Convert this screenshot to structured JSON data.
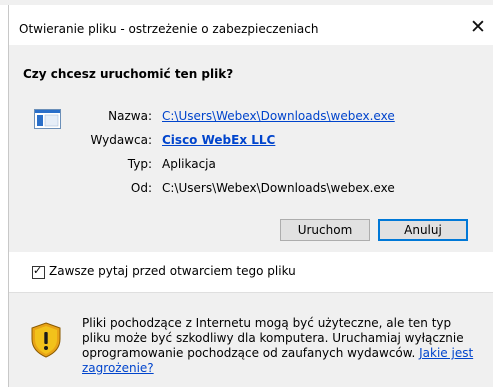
{
  "window": {
    "title": "Otwieranie pliku - ostrzeżenie o zabezpieczeniach",
    "close_glyph": "✕"
  },
  "main": {
    "heading": "Czy chcesz uruchomić ten plik?",
    "icon": "executable-file-icon",
    "fields": {
      "name_label": "Nazwa:",
      "name_value": "C:\\Users\\Webex\\Downloads\\webex.exe",
      "publisher_label": "Wydawca:",
      "publisher_value": "Cisco WebEx LLC",
      "type_label": "Typ:",
      "type_value": "Aplikacja",
      "from_label": "Od:",
      "from_value": "C:\\Users\\Webex\\Downloads\\webex.exe"
    },
    "buttons": {
      "run": "Uruchom",
      "cancel": "Anuluj"
    }
  },
  "checkbox": {
    "label": "Zawsze pytaj przed otwarciem tego pliku",
    "checked": true,
    "check_glyph": "✓"
  },
  "warning": {
    "icon": "shield-warning-icon",
    "text": "Pliki pochodzące z Internetu mogą być użyteczne, ale ten typ pliku może być szkodliwy dla komputera. Uruchamiaj wyłącznie oprogramowanie pochodzące od zaufanych wydawców.",
    "link": "Jakie jest zagrożenie?"
  },
  "colors": {
    "link": "#0044cc",
    "panel": "#f0f0f0",
    "button_focus_border": "#0078d7",
    "shield_yellow": "#f2c21b"
  }
}
